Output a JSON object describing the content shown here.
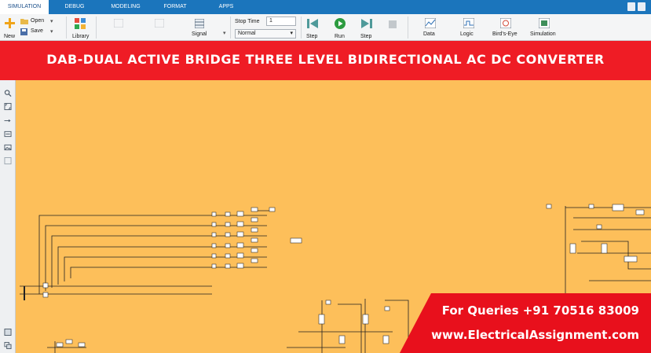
{
  "ribbon": {
    "tabs": [
      {
        "label": "SIMULATION",
        "active": true
      },
      {
        "label": "DEBUG",
        "active": false
      },
      {
        "label": "MODELING",
        "active": false
      },
      {
        "label": "FORMAT",
        "active": false
      },
      {
        "label": "APPS",
        "active": false
      }
    ]
  },
  "toolbar": {
    "new_label": "New",
    "open_label": "Open",
    "save_label": "Save",
    "library_label": "Library",
    "signal_label": "Signal",
    "stop_time_label": "Stop Time",
    "stop_time_value": "1",
    "mode_value": "Normal",
    "step_back_label": "Step",
    "run_label": "Run",
    "step_forward_label": "Step",
    "data_label": "Data",
    "logic_label": "Logic",
    "birds_eye_label": "Bird's-Eye",
    "simulation_label": "Simulation"
  },
  "banner": {
    "title": "DAB-DUAL ACTIVE BRIDGE THREE LEVEL BIDIRECTIONAL AC DC CONVERTER"
  },
  "contact": {
    "queries": "For Queries +91 70516 83009",
    "website": "www.ElectricalAssignment.com"
  },
  "colors": {
    "ribbon_blue": "#1b75bc",
    "banner_red": "#ef1c25",
    "canvas_orange": "#fdbf5a",
    "overlay_red": "#e8101c"
  },
  "icons": {
    "new": "plus-icon",
    "open": "folder-icon",
    "save": "save-icon",
    "library": "library-icon",
    "run": "play-icon",
    "step_back": "step-back-icon",
    "step_forward": "step-forward-icon",
    "stop": "stop-icon",
    "data": "data-inspector-icon",
    "logic": "logic-analyzer-icon",
    "birds_eye": "birds-eye-icon",
    "simulation": "simulation-manager-icon"
  }
}
